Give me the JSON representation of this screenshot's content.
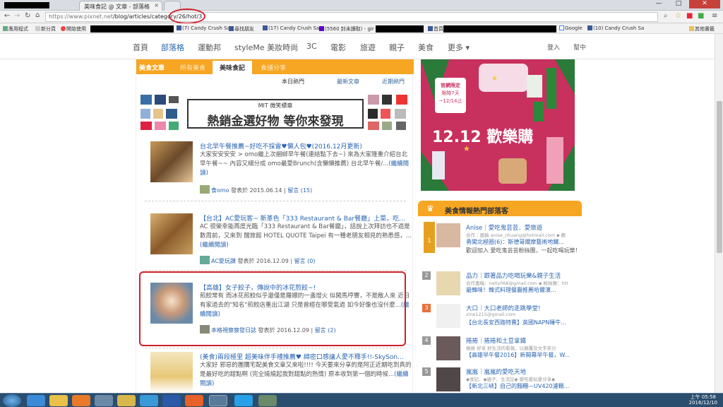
{
  "browser": {
    "tabs": [
      {
        "label": "美味食記 @ 文章 - 部落格"
      }
    ],
    "window_controls": {
      "minimize": "—",
      "maximize": "□",
      "close": "✕"
    },
    "url_host": "https://www.pixnet.net",
    "url_path": "/blog/articles/category/26/hot/3",
    "bookmarks": [
      {
        "label": "應用程式",
        "icon": "apps-icon"
      },
      {
        "label": "新分頁",
        "icon": "page-icon"
      },
      {
        "label": "開始使用",
        "icon": "chrome-icon"
      },
      {
        "label": "(7) Candy Crush Sag",
        "icon": "facebook-icon"
      },
      {
        "label": "尋找朋友",
        "icon": "facebook-icon"
      },
      {
        "label": "(17) Candy Crush Sa",
        "icon": "facebook-icon"
      },
      {
        "label": "(5560 封未讀取) - gir",
        "icon": "yahoo-icon"
      },
      {
        "label": "首頁",
        "icon": "facebook-icon"
      },
      {
        "label": "Google",
        "icon": "google-icon"
      },
      {
        "label": "(10) Candy Crush Sa",
        "icon": "facebook-icon"
      },
      {
        "label": "其他書籤",
        "icon": "folder-icon"
      }
    ]
  },
  "site_nav": {
    "items": [
      "首頁",
      "部落格",
      "運動邦",
      "styleMe 美妝時尚",
      "3C",
      "電影",
      "旅遊",
      "親子",
      "美食",
      "更多 ▾"
    ],
    "active": "部落格",
    "login": "登入",
    "help": "幫中"
  },
  "category_tabs": {
    "items": [
      "美食文章",
      "所有美食",
      "美味食記",
      "食譜分享"
    ],
    "active": "美味食記"
  },
  "sub_tabs": [
    "本日熱門",
    "最新文章",
    "近期熱門"
  ],
  "banner": {
    "small": "MIT 微笑標章",
    "big": "熱銷金選好物 等你來發現"
  },
  "articles": [
    {
      "title": "台北早午餐推薦~好吃不採雷♥懶人包♥(2016.12月更新)",
      "desc": "大家安安安安 > omo繼上次綑綁早午餐(連結點下去~) 來為大家隆重介紹台北早午餐~~ 內容又細分成 omo最愛Brunch(含懶懶推薦) 台北早午餐/...",
      "more": "(繼續閱讀)",
      "author": "食omo",
      "posted": "發表於 2015.06.14",
      "comments": "留言 (15)"
    },
    {
      "title": "【台北】AC愛玩客~ 新革色「333 Restaurant & Bar餐廳」上菜，吃...",
      "desc": "AC 很榮幸能再度光臨「333 Restaurant & Bar餐廳」，話說上次拜訪也不過是數周前，又來到 闊旅館 HOTEL QUOTE Taipei 有一種老朋友相見的熟悉感，...",
      "more": "(繼續閱讀)",
      "author": "AC愛玩課",
      "posted": "發表於 2016.12.09",
      "comments": "留言 (0)"
    },
    {
      "title": "【高雄】女子餃子，傳說中的冰花煎餃~!",
      "desc": "煎餃常有 而冰花煎餃似乎還僅是羅娜的一盞燈火 似闖馬哼響，不是敵人來 近日有家過去的\"知名\"煎餃店重出江湖 只是曾經在哪受氣過 如今好像也沒什麼...",
      "more": "(繼續閱讀)",
      "author": "本格視察察發日誌",
      "posted": "發表於 2016.12.09",
      "comments": "留言 (2)"
    },
    {
      "title": "(美食)兩段極里 超美味伴手禮推薦♥ 綿密口感讓人愛不釋手!!-SkySon...",
      "desc": "大家好 邪惡的團購宅配美食文章又來啦!!!! 今天要來分享的是阿正近期吃到真的是最好吃的甜點啊 (完全燒燒起我對甜點的熱情) 原本收到第一個的時候...",
      "more": "(繼續閱讀)"
    }
  ],
  "ad": {
    "tag_line1": "官網限定",
    "tag_line2": "限時7天",
    "tag_line3": "~12/14止",
    "headline": "12.12 歡樂購"
  },
  "sidebar": {
    "title": "美食情報熱門部落客",
    "bloggers": [
      {
        "rank": "1",
        "name": "Anise｜愛吃鬼芸芸．愛旅遊",
        "sub": "合作｜邀稿 anise_chuang@hotmail.com ▪ 歡",
        "title": "勇闖北極圈(6)：斯德哥爾摩藝術地鐵...",
        "extra": "歡迎加入 愛吃鬼芸芸粉絲團，一起吃喝玩樂！跟小兔抵達斯德..."
      },
      {
        "rank": "2",
        "name": "品力｜跟著品力吃喝玩樂&親子生活",
        "sub": "合作邀稿：nelly068@gmail.com ▪ 粉絲團：htt",
        "title": "最韓味！韓式料理餐廳推薦哈爾濱...",
        "extra": ""
      },
      {
        "rank": "3",
        "name": "大口｜大口老師的走跳學堂!",
        "sub": "zine1215@gmail.com",
        "title": "【台北長安西路特賣】英國NAPN睡牛...",
        "extra": ""
      },
      {
        "rank": "4",
        "name": "捲捲｜捲捲和土豆拿鐵",
        "sub": "捲捲 好享 好生活的看報，以顛覆及文字來分",
        "title": "【高雄早午餐2016】新開幕早午餐，W...",
        "extra": ""
      },
      {
        "rank": "5",
        "name": "嵐嵐｜嵐嵐的愛吃天地",
        "sub": "◆食記、◆親子、生活記◆ 愛吃愛玩愛分享◆",
        "title": "【新北三峽】自己的麵糰—UV420濾顆...",
        "extra": ""
      }
    ]
  },
  "taskbar": {
    "time": "上午 05:58",
    "date": "2016/12/10",
    "apps": [
      "ie-icon",
      "explorer-icon",
      "media-icon",
      "folder-icon",
      "app-icon",
      "ie-icon",
      "word-icon",
      "firefox-icon",
      "chrome-icon",
      "skype-icon",
      "app-icon"
    ]
  },
  "colors": {
    "accent": "#f6a623",
    "link": "#2a64b0",
    "highlight": "#d0202a",
    "ad_bg": "#d23a6a"
  }
}
